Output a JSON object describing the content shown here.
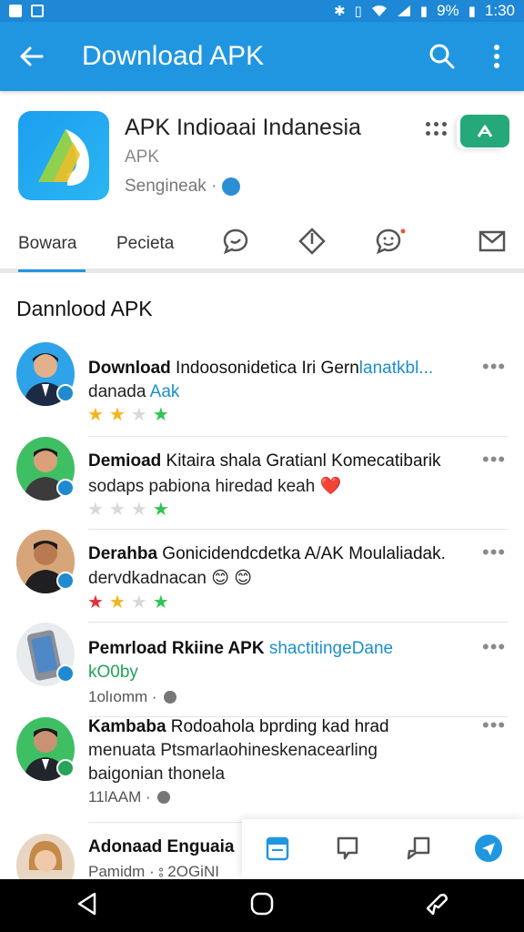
{
  "status_bar": {
    "battery": "9%",
    "time": "1:30"
  },
  "app_bar": {
    "title": "Download APK"
  },
  "app": {
    "name": "APK Indioaai Indanesia",
    "subtitle": "APK",
    "developer": "Sengineak ·"
  },
  "tabs": {
    "first": "Bowara",
    "second": "Pecieta"
  },
  "section_title": "Dannlood APK",
  "items": [
    {
      "title_bold": "Download",
      "title_rest": " Indoosonidetica Iri Gern",
      "title_accent": "lanatkbl...",
      "sub": "danada ",
      "sub_accent": "Aak",
      "stars": [
        "gold",
        "gold",
        "grey",
        "green"
      ]
    },
    {
      "title_bold": "Demioad",
      "title_rest": " Kitaira shala Gratianl Komecatibarik",
      "line2": "sodaps pabiona hiredad keah ❤️",
      "stars": [
        "grey",
        "grey",
        "grey",
        "green"
      ]
    },
    {
      "title_bold": "Derahba",
      "title_rest": " Gonicidendcdetka A/AK Moulaliadak.",
      "line2": "dervdkadnacan 😊 😊",
      "stars": [
        "red",
        "gold",
        "grey",
        "green"
      ]
    },
    {
      "title_bold": "Pemrload",
      "title_rest": " Rkiine APK ",
      "title_accent": "shactitingeDane",
      "line2_accent": "kO0by",
      "meta": "1olıomm ·"
    },
    {
      "title_bold": "Kambaba",
      "title_rest": " Rodoahola bprding kad hrad",
      "line2": "menuata Ptsmarlaohineskenacearling",
      "line3": "baigonian thonela",
      "meta": "11lAAM ·"
    },
    {
      "title_bold": "Adonaad",
      "title_rest": " Enguaia",
      "meta": "Pamidm · ⦂ 2OGiNI"
    }
  ],
  "colors": {
    "primary": "#2196e0",
    "status": "#1e88d6",
    "install": "#25a97a",
    "accent": "#1b8fca"
  }
}
